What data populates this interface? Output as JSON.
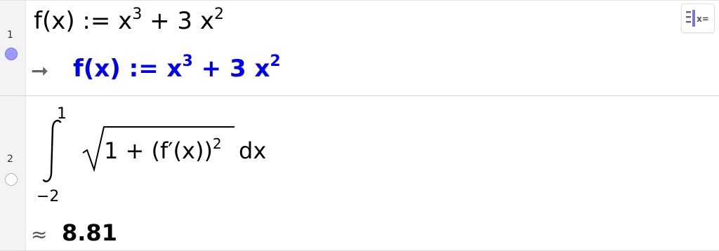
{
  "rows": [
    {
      "number": "1",
      "input": {
        "lhs": "f(x) := x",
        "exp1": "3",
        "mid": " + 3 x",
        "exp2": "2"
      },
      "output": {
        "arrow": "➞",
        "lhs": "f(x) := x",
        "exp1": "3",
        "mid": " + 3 x",
        "exp2": "2"
      },
      "marble_active": true
    },
    {
      "number": "2",
      "integral": {
        "upper": "1",
        "lower": "−2",
        "radicand_prefix": "1 + (f′(x))",
        "radicand_exp": "2",
        "differential": "dx"
      },
      "output": {
        "approx": "≈",
        "value": "8.81"
      },
      "marble_active": false
    }
  ],
  "toolbar": {
    "algebra_icon": "algebra-description-icon",
    "icon_text": "x="
  },
  "colors": {
    "accent": "#0000ee",
    "marble_on": "#9999ff",
    "gutter": "#f3f3f3"
  }
}
